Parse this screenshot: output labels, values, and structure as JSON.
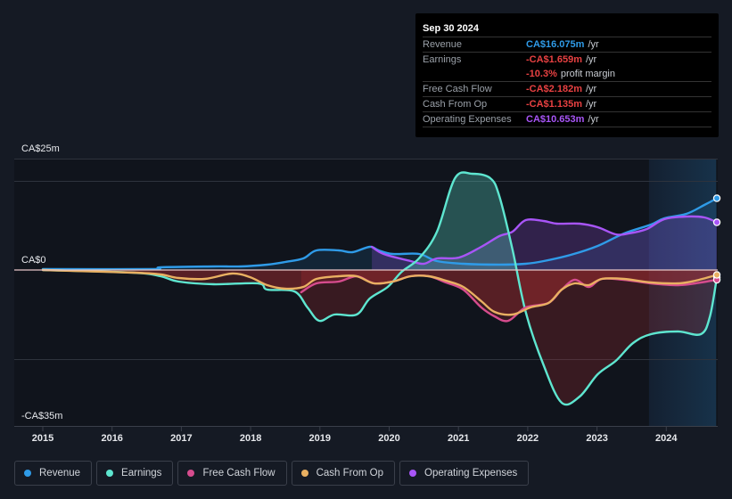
{
  "tooltip": {
    "date": "Sep 30 2024",
    "rows": [
      {
        "label": "Revenue",
        "value": "CA$16.075m",
        "unit": "/yr",
        "color": "#2f9be8"
      },
      {
        "label": "Earnings",
        "value": "-CA$1.659m",
        "unit": "/yr",
        "color": "#e84142"
      },
      {
        "label": "",
        "value": "-10.3%",
        "unit": "profit margin",
        "color": "#e84142"
      },
      {
        "label": "Free Cash Flow",
        "value": "-CA$2.182m",
        "unit": "/yr",
        "color": "#e84142"
      },
      {
        "label": "Cash From Op",
        "value": "-CA$1.135m",
        "unit": "/yr",
        "color": "#e84142"
      },
      {
        "label": "Operating Expenses",
        "value": "CA$10.653m",
        "unit": "/yr",
        "color": "#a855f7"
      }
    ]
  },
  "legend": [
    {
      "label": "Revenue",
      "color": "#2f9be8"
    },
    {
      "label": "Earnings",
      "color": "#5ee6d0"
    },
    {
      "label": "Free Cash Flow",
      "color": "#d64c8e"
    },
    {
      "label": "Cash From Op",
      "color": "#e9b062"
    },
    {
      "label": "Operating Expenses",
      "color": "#a855f7"
    }
  ],
  "chart_data": {
    "type": "line",
    "title": "",
    "xlabel": "",
    "ylabel": "",
    "y_tick_labels": [
      "CA$25m",
      "CA$0",
      "-CA$35m"
    ],
    "y_ticks": [
      25,
      0,
      -35
    ],
    "ylim": [
      -35,
      25
    ],
    "xlim": [
      2014.57,
      2024.72
    ],
    "x_tick_labels": [
      "2015",
      "2016",
      "2017",
      "2018",
      "2019",
      "2020",
      "2021",
      "2022",
      "2023",
      "2024"
    ],
    "x_ticks": [
      2015,
      2016,
      2017,
      2018,
      2019,
      2020,
      2021,
      2022,
      2023,
      2024
    ],
    "gridlines": [
      25,
      20,
      0,
      -20
    ],
    "grid": true,
    "highlight_range": [
      2023.75,
      2024.72
    ],
    "series": [
      {
        "name": "Revenue",
        "color": "#2f9be8",
        "x": [
          2015.0,
          2016.57,
          2016.7,
          2017.47,
          2017.86,
          2018.24,
          2018.5,
          2018.76,
          2018.95,
          2019.27,
          2019.47,
          2019.72,
          2019.85,
          2020.05,
          2020.43,
          2020.69,
          2021.07,
          2021.59,
          2021.97,
          2022.23,
          2022.62,
          2023.01,
          2023.39,
          2023.78,
          2023.97,
          2024.29,
          2024.55,
          2024.73
        ],
        "y": [
          0.2,
          0.2,
          0.6,
          0.8,
          0.8,
          1.2,
          1.8,
          2.6,
          4.4,
          4.4,
          4.0,
          5.2,
          4.4,
          3.6,
          3.6,
          2.0,
          1.4,
          1.2,
          1.4,
          2.0,
          3.4,
          5.4,
          8.2,
          10.2,
          11.6,
          12.6,
          14.6,
          16.1
        ]
      },
      {
        "name": "Earnings",
        "color": "#5ee6d0",
        "x": [
          2015.0,
          2016.31,
          2016.7,
          2016.96,
          2017.47,
          2018.11,
          2018.24,
          2018.63,
          2018.82,
          2018.99,
          2019.21,
          2019.53,
          2019.72,
          2019.98,
          2020.18,
          2020.43,
          2020.69,
          2020.95,
          2021.2,
          2021.46,
          2021.59,
          2021.78,
          2021.97,
          2022.23,
          2022.49,
          2022.75,
          2023.01,
          2023.27,
          2023.52,
          2023.78,
          2024.17,
          2024.5,
          2024.63,
          2024.73
        ],
        "y": [
          0,
          -0.6,
          -1.4,
          -2.6,
          -3.2,
          -3.0,
          -4.4,
          -4.8,
          -8.4,
          -11.4,
          -10.0,
          -10.0,
          -6.4,
          -3.8,
          -0.4,
          2.6,
          8.6,
          20.6,
          21.6,
          20.6,
          16.6,
          4.6,
          -9.4,
          -21.4,
          -29.8,
          -28.4,
          -23.4,
          -20.4,
          -16.4,
          -14.4,
          -13.8,
          -14.4,
          -10.4,
          -1.7
        ]
      },
      {
        "name": "Free Cash Flow",
        "color": "#d64c8e",
        "x": [
          2018.73,
          2018.95,
          2019.27,
          2019.53,
          2019.78,
          2020.05,
          2020.31,
          2020.57,
          2020.82,
          2021.07,
          2021.33,
          2021.52,
          2021.72,
          2021.97,
          2022.3,
          2022.49,
          2022.68,
          2022.88,
          2023.07,
          2023.39,
          2023.78,
          2024.17,
          2024.42,
          2024.73
        ],
        "y": [
          -5.0,
          -3.0,
          -2.6,
          -1.4,
          -3.0,
          -2.6,
          -1.4,
          -1.4,
          -2.8,
          -4.4,
          -8.4,
          -10.4,
          -11.4,
          -8.4,
          -7.4,
          -4.4,
          -2.2,
          -3.8,
          -2.0,
          -2.2,
          -3.0,
          -3.4,
          -3.0,
          -2.2
        ]
      },
      {
        "name": "Cash From Op",
        "color": "#e9b062",
        "x": [
          2015.0,
          2016.31,
          2016.7,
          2016.96,
          2017.34,
          2017.73,
          2017.99,
          2018.24,
          2018.5,
          2018.76,
          2018.95,
          2019.27,
          2019.53,
          2019.78,
          2020.05,
          2020.31,
          2020.57,
          2020.82,
          2021.07,
          2021.33,
          2021.52,
          2021.78,
          2022.04,
          2022.3,
          2022.49,
          2022.68,
          2022.88,
          2023.07,
          2023.39,
          2023.78,
          2024.17,
          2024.42,
          2024.73
        ],
        "y": [
          0,
          -0.6,
          -1.0,
          -1.8,
          -2.0,
          -0.8,
          -1.6,
          -3.4,
          -4.2,
          -3.8,
          -2.0,
          -1.4,
          -1.4,
          -3.0,
          -2.6,
          -1.4,
          -1.4,
          -2.4,
          -3.8,
          -7.0,
          -9.4,
          -10.0,
          -8.4,
          -7.4,
          -4.4,
          -3.0,
          -3.4,
          -2.0,
          -2.0,
          -2.8,
          -3.0,
          -2.4,
          -1.1
        ]
      },
      {
        "name": "Operating Expenses",
        "color": "#a855f7",
        "x": [
          2019.75,
          2019.92,
          2020.31,
          2020.5,
          2020.69,
          2021.01,
          2021.33,
          2021.59,
          2021.78,
          2021.97,
          2022.23,
          2022.42,
          2022.75,
          2023.01,
          2023.27,
          2023.46,
          2023.72,
          2023.97,
          2024.29,
          2024.55,
          2024.73
        ],
        "y": [
          5.2,
          3.6,
          2.0,
          1.4,
          2.6,
          2.8,
          5.2,
          7.6,
          8.6,
          11.2,
          11.0,
          10.4,
          10.4,
          9.6,
          8.0,
          8.2,
          9.2,
          11.4,
          12.0,
          11.8,
          10.7
        ]
      }
    ]
  }
}
